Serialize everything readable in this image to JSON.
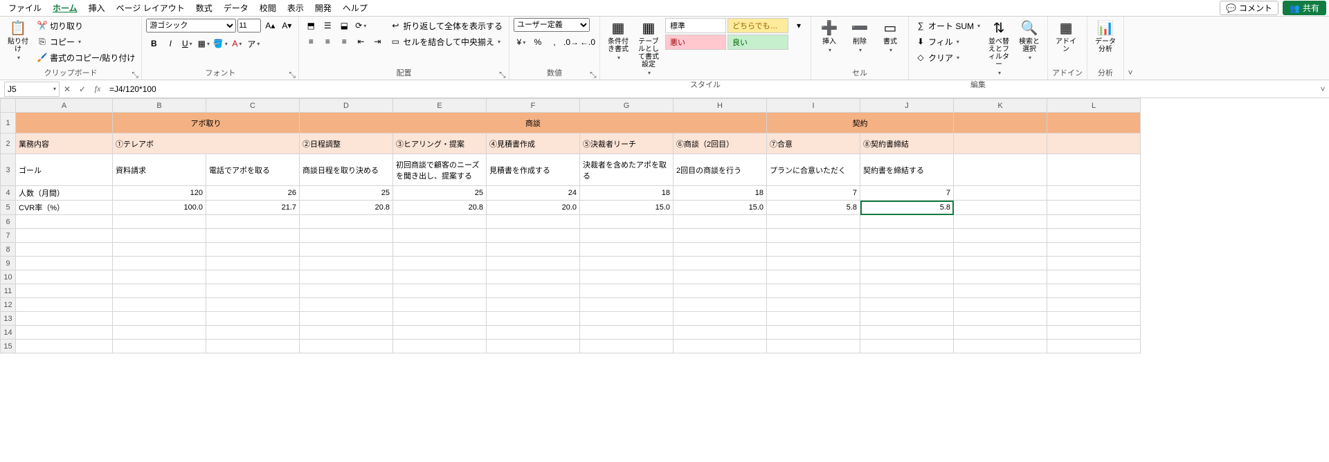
{
  "menubar": {
    "items": [
      "ファイル",
      "ホーム",
      "挿入",
      "ページ レイアウト",
      "数式",
      "データ",
      "校閲",
      "表示",
      "開発",
      "ヘルプ"
    ],
    "active_index": 1,
    "comment": "コメント",
    "share": "共有"
  },
  "ribbon": {
    "clipboard": {
      "paste": "貼り付け",
      "cut": "切り取り",
      "copy": "コピー",
      "format_painter": "書式のコピー/貼り付け",
      "group_label": "クリップボード"
    },
    "font": {
      "name": "游ゴシック",
      "size": "11",
      "group_label": "フォント"
    },
    "alignment": {
      "wrap": "折り返して全体を表示する",
      "merge": "セルを結合して中央揃え",
      "group_label": "配置"
    },
    "number": {
      "format": "ユーザー定義",
      "group_label": "数値"
    },
    "styles": {
      "cond_fmt": "条件付き書式",
      "table_fmt": "テーブルとして書式設定",
      "cell_styles": {
        "normal": "標準",
        "neutral": "どちらでも…",
        "bad": "悪い",
        "good": "良い"
      },
      "group_label": "スタイル"
    },
    "cells": {
      "insert": "挿入",
      "delete": "削除",
      "format": "書式",
      "group_label": "セル"
    },
    "editing": {
      "autosum": "オート SUM",
      "fill": "フィル",
      "clear": "クリア",
      "sort_filter": "並べ替えとフィルター",
      "find": "検索と選択",
      "group_label": "編集"
    },
    "addins": {
      "label": "アドイン",
      "group_label": "アドイン"
    },
    "analysis": {
      "label": "データ分析",
      "group_label": "分析"
    }
  },
  "formula_bar": {
    "cell_ref": "J5",
    "formula": "=J4/120*100"
  },
  "columns": [
    "A",
    "B",
    "C",
    "D",
    "E",
    "F",
    "G",
    "H",
    "I",
    "J",
    "K",
    "L"
  ],
  "selected_col": "J",
  "selected_cell": "J5",
  "row_labels": [
    "1",
    "2",
    "3",
    "4",
    "5",
    "6",
    "7",
    "8",
    "9",
    "10",
    "11",
    "12",
    "13",
    "14",
    "15"
  ],
  "sheet": {
    "group_row": {
      "B": "アボ取り",
      "E": "商談",
      "I": "契約"
    },
    "header_row": {
      "A": "業務内容",
      "B": "①テレアボ",
      "D": "②日程調整",
      "E": "③ヒアリング・提案",
      "F": "④見積書作成",
      "G": "⑤決裁者リーチ",
      "H": "⑥商談（2回目）",
      "I": "⑦合意",
      "J": "⑧契約書締結"
    },
    "goal_row": {
      "A": "ゴール",
      "B": "資料請求",
      "C": "電話でアポを取る",
      "D": "商談日程を取り決める",
      "E": "初回商談で顧客のニーズを聞き出し、提案する",
      "F": "見積書を作成する",
      "G": "決裁者を含めたアポを取る",
      "H": "2回目の商談を行う",
      "I": "プランに合意いただく",
      "J": "契約書を締結する"
    },
    "count_row": {
      "A": "人数（月間）",
      "B": 120,
      "C": 26,
      "D": 25,
      "E": 25,
      "F": 24,
      "G": 18,
      "H": 18,
      "I": 7,
      "J": 7
    },
    "cvr_row": {
      "A": "CVR率（%）",
      "B": "100.0",
      "C": "21.7",
      "D": "20.8",
      "E": "20.8",
      "F": "20.0",
      "G": "15.0",
      "H": "15.0",
      "I": "5.8",
      "J": "5.8"
    }
  }
}
